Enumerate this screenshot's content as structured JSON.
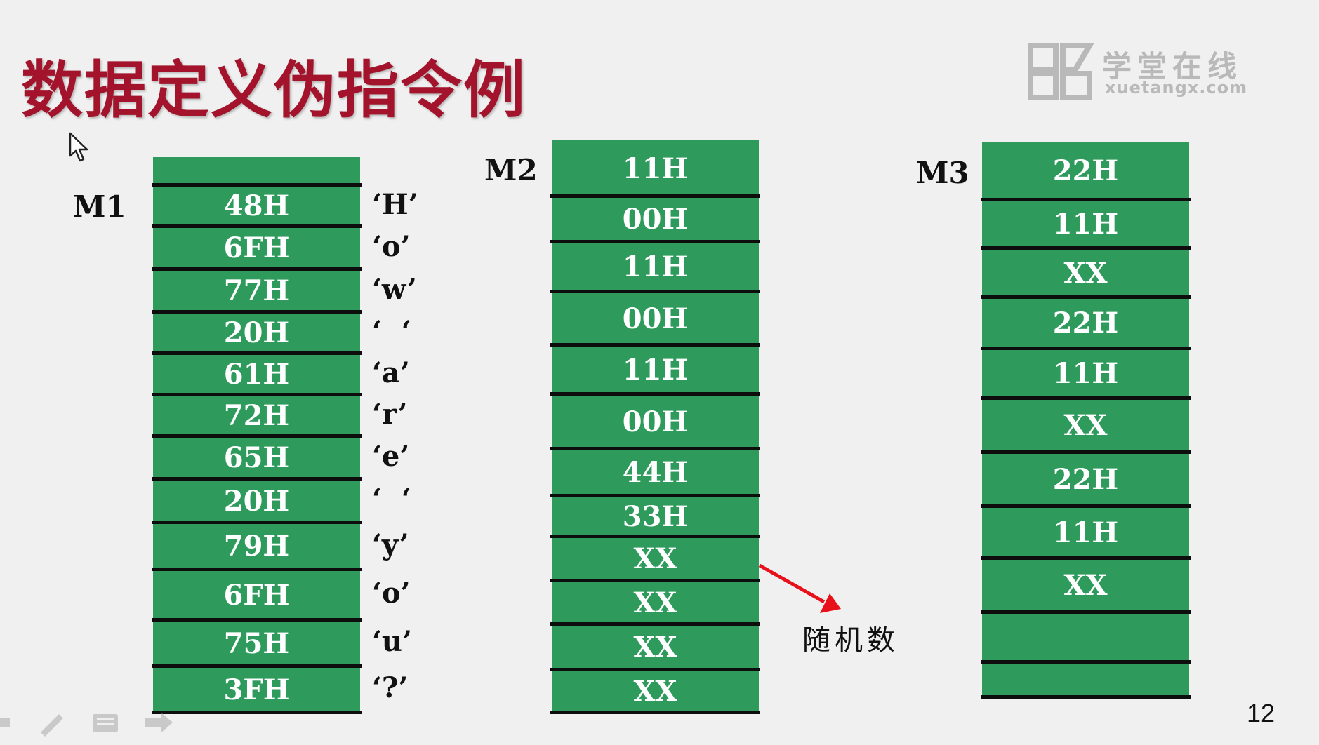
{
  "title": "数据定义伪指令例",
  "watermark": {
    "name": "学堂在线",
    "domain": "xuetangx.com"
  },
  "page_number": "12",
  "random_label": "随机数",
  "colors": {
    "cell_green": "#2e9b5c",
    "title_red": "#a3142c",
    "arrow_red": "#e8101a"
  },
  "m1": {
    "label": "M1",
    "cells": [
      "",
      "48H",
      "6FH",
      "77H",
      "20H",
      "61H",
      "72H",
      "65H",
      "20H",
      "79H",
      "6FH",
      "75H",
      "3FH"
    ],
    "chars": [
      "‘H’",
      "‘o’",
      "‘w’",
      "‘  ‘",
      "‘a’",
      "‘r’",
      "‘e’",
      "‘  ‘",
      "‘y’",
      "‘o’",
      "‘u’",
      "‘?’"
    ]
  },
  "m2": {
    "label": "M2",
    "cells": [
      "11H",
      "00H",
      "11H",
      "00H",
      "11H",
      "00H",
      "44H",
      "33H",
      "XX",
      "XX",
      "XX",
      "XX"
    ]
  },
  "m3": {
    "label": "M3",
    "cells": [
      "22H",
      "11H",
      "XX",
      "22H",
      "11H",
      "XX",
      "22H",
      "11H",
      "XX",
      "",
      ""
    ]
  },
  "icons": [
    "cursor-arrow-icon",
    "pen-icon",
    "menu-icon",
    "forward-icon",
    "xuetangx-logo-icon"
  ]
}
